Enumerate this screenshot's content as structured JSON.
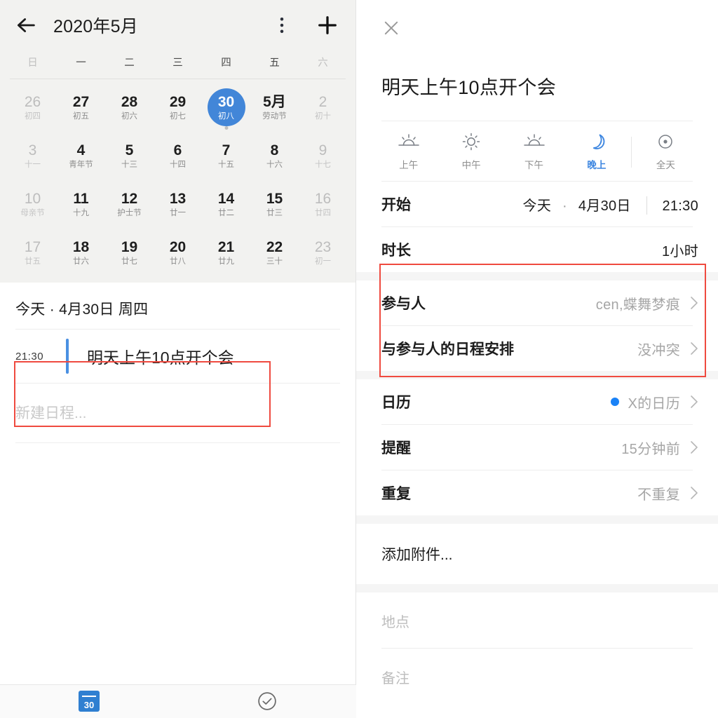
{
  "calendar": {
    "title": "2020年5月",
    "icons": {
      "back": "arrow-left-icon",
      "menu": "more-vertical-icon",
      "add": "plus-icon"
    },
    "weekdays": [
      {
        "label": "日",
        "dim": true
      },
      {
        "label": "一",
        "dim": false
      },
      {
        "label": "二",
        "dim": false
      },
      {
        "label": "三",
        "dim": false
      },
      {
        "label": "四",
        "dim": false
      },
      {
        "label": "五",
        "dim": false
      },
      {
        "label": "六",
        "dim": true
      }
    ],
    "days": [
      {
        "num": "26",
        "sub": "初四",
        "dim": true,
        "selected": false,
        "marked": false
      },
      {
        "num": "27",
        "sub": "初五",
        "dim": false,
        "selected": false,
        "marked": false
      },
      {
        "num": "28",
        "sub": "初六",
        "dim": false,
        "selected": false,
        "marked": false
      },
      {
        "num": "29",
        "sub": "初七",
        "dim": false,
        "selected": false,
        "marked": false
      },
      {
        "num": "30",
        "sub": "初八",
        "dim": false,
        "selected": true,
        "marked": true
      },
      {
        "num": "5月",
        "sub": "劳动节",
        "dim": false,
        "selected": false,
        "marked": false
      },
      {
        "num": "2",
        "sub": "初十",
        "dim": true,
        "selected": false,
        "marked": false
      },
      {
        "num": "3",
        "sub": "十一",
        "dim": true,
        "selected": false,
        "marked": false
      },
      {
        "num": "4",
        "sub": "青年节",
        "dim": false,
        "selected": false,
        "marked": false
      },
      {
        "num": "5",
        "sub": "十三",
        "dim": false,
        "selected": false,
        "marked": false
      },
      {
        "num": "6",
        "sub": "十四",
        "dim": false,
        "selected": false,
        "marked": false
      },
      {
        "num": "7",
        "sub": "十五",
        "dim": false,
        "selected": false,
        "marked": false
      },
      {
        "num": "8",
        "sub": "十六",
        "dim": false,
        "selected": false,
        "marked": false
      },
      {
        "num": "9",
        "sub": "十七",
        "dim": true,
        "selected": false,
        "marked": false
      },
      {
        "num": "10",
        "sub": "母亲节",
        "dim": true,
        "selected": false,
        "marked": false
      },
      {
        "num": "11",
        "sub": "十九",
        "dim": false,
        "selected": false,
        "marked": false
      },
      {
        "num": "12",
        "sub": "护士节",
        "dim": false,
        "selected": false,
        "marked": false
      },
      {
        "num": "13",
        "sub": "廿一",
        "dim": false,
        "selected": false,
        "marked": false
      },
      {
        "num": "14",
        "sub": "廿二",
        "dim": false,
        "selected": false,
        "marked": false
      },
      {
        "num": "15",
        "sub": "廿三",
        "dim": false,
        "selected": false,
        "marked": false
      },
      {
        "num": "16",
        "sub": "廿四",
        "dim": true,
        "selected": false,
        "marked": false
      },
      {
        "num": "17",
        "sub": "廿五",
        "dim": true,
        "selected": false,
        "marked": false
      },
      {
        "num": "18",
        "sub": "廿六",
        "dim": false,
        "selected": false,
        "marked": false
      },
      {
        "num": "19",
        "sub": "廿七",
        "dim": false,
        "selected": false,
        "marked": false
      },
      {
        "num": "20",
        "sub": "廿八",
        "dim": false,
        "selected": false,
        "marked": false
      },
      {
        "num": "21",
        "sub": "廿九",
        "dim": false,
        "selected": false,
        "marked": false
      },
      {
        "num": "22",
        "sub": "三十",
        "dim": false,
        "selected": false,
        "marked": false
      },
      {
        "num": "23",
        "sub": "初一",
        "dim": true,
        "selected": false,
        "marked": false
      }
    ]
  },
  "agenda": {
    "date_header": "今天 · 4月30日  周四",
    "event": {
      "time": "21:30",
      "title": "明天上午10点开个会"
    },
    "new_event_placeholder": "新建日程..."
  },
  "bottom_nav": {
    "calendar_day": "30",
    "items": [
      "calendar-tab",
      "tasks-tab"
    ]
  },
  "detail": {
    "close_label": "×",
    "heading": "明天上午10点开个会",
    "time_of_day": [
      {
        "label": "上午",
        "icon": "sunrise-icon",
        "active": false
      },
      {
        "label": "中午",
        "icon": "sun-icon",
        "active": false
      },
      {
        "label": "下午",
        "icon": "sunset-icon",
        "active": false
      },
      {
        "label": "晚上",
        "icon": "moon-icon",
        "active": true
      },
      {
        "label": "全天",
        "icon": "all-day-icon",
        "active": false
      }
    ],
    "start": {
      "label": "开始",
      "day": "今天",
      "separator": "·",
      "date": "4月30日",
      "time": "21:30"
    },
    "duration": {
      "label": "时长",
      "value": "1小时"
    },
    "participants": {
      "label": "参与人",
      "value": "cen,蝶舞梦痕"
    },
    "schedule_conflict": {
      "label": "与参与人的日程安排",
      "value": "没冲突"
    },
    "calendar_row": {
      "label": "日历",
      "value": "X的日历",
      "dot_color": "#1a82f7"
    },
    "reminder": {
      "label": "提醒",
      "value": "15分钟前"
    },
    "repeat": {
      "label": "重复",
      "value": "不重复"
    },
    "attachment": "添加附件...",
    "location_placeholder": "地点",
    "notes_placeholder": "备注"
  },
  "annotations": {
    "highlight_color": "#ef4a3f",
    "boxes": [
      "event-row-highlight",
      "participants-section-highlight"
    ]
  }
}
